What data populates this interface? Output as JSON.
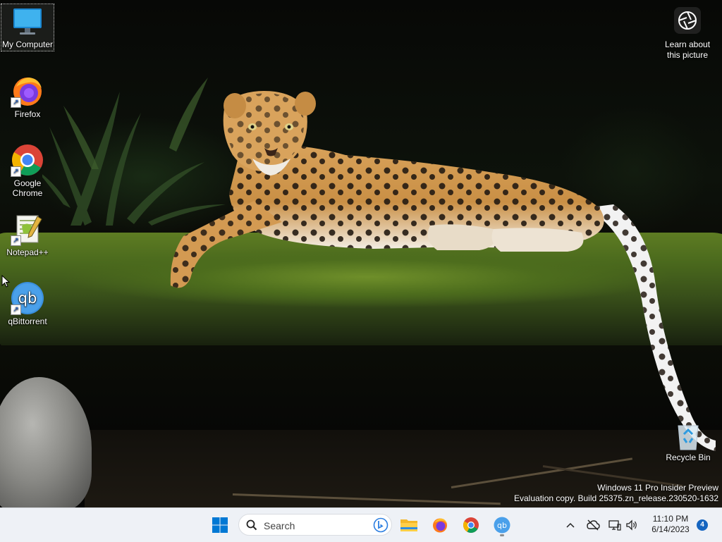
{
  "desktop": {
    "icons": [
      {
        "label": "My Computer"
      },
      {
        "label": "Firefox"
      },
      {
        "label": "Google Chrome"
      },
      {
        "label": "Notepad++"
      },
      {
        "label": "qBittorrent"
      }
    ],
    "recycle_bin": {
      "label": "Recycle Bin"
    },
    "learn_about": {
      "line1": "Learn about",
      "line2": "this picture"
    },
    "watermark": {
      "line1": "Windows 11 Pro Insider Preview",
      "line2": "Evaluation copy. Build 25375.zn_release.230520-1632"
    }
  },
  "taskbar": {
    "search_placeholder": "Search",
    "pinned_icons": [
      "windows-start-icon",
      "file-explorer-icon",
      "firefox-icon",
      "chrome-icon",
      "qbittorrent-icon"
    ],
    "tray": {
      "time": "11:10 PM",
      "date": "6/14/2023",
      "notification_count": "4"
    }
  },
  "colors": {
    "taskbar_bg": "#eef1f6",
    "accent": "#1565c0",
    "windows_blue": "#0078d4"
  }
}
